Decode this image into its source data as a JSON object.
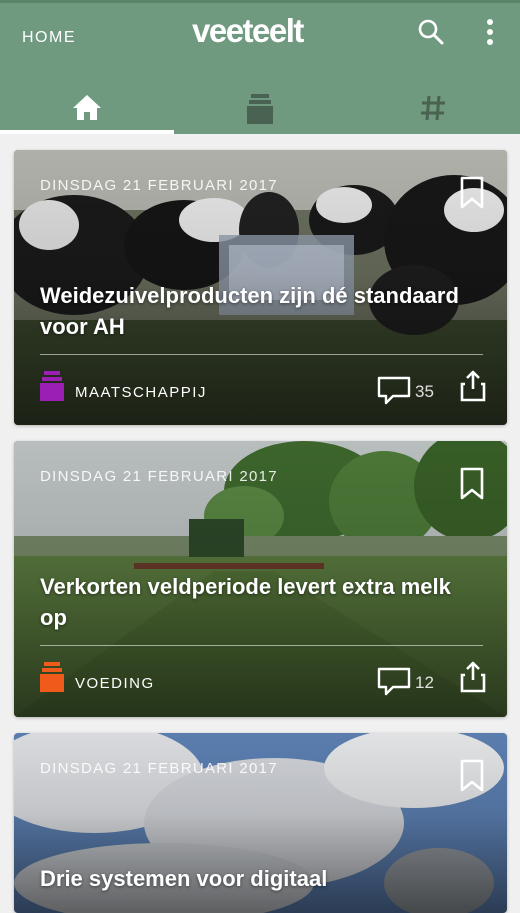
{
  "header": {
    "home_label": "HOME",
    "logo_text": "veeteelt",
    "background": "#6f9a7f",
    "icons": [
      "search-icon",
      "more-vert-icon"
    ]
  },
  "tabs": [
    {
      "icon": "home-icon",
      "active": true
    },
    {
      "icon": "category-stack-icon",
      "active": false
    },
    {
      "icon": "hashtag-icon",
      "active": false
    }
  ],
  "articles": [
    {
      "date": "DINSDAG 21 FEBRUARI 2017",
      "title": "Weidezuivelproducten zijn dé standaard voor AH",
      "category": "MAATSCHAPPIJ",
      "category_color": "#9b1fb5",
      "comments": "35"
    },
    {
      "date": "DINSDAG 21 FEBRUARI 2017",
      "title": "Verkorten veldperiode levert extra melk op",
      "category": "VOEDING",
      "category_color": "#f05a1a",
      "comments": "12"
    },
    {
      "date": "DINSDAG 21 FEBRUARI 2017",
      "title": "Drie systemen voor digitaal"
    }
  ]
}
